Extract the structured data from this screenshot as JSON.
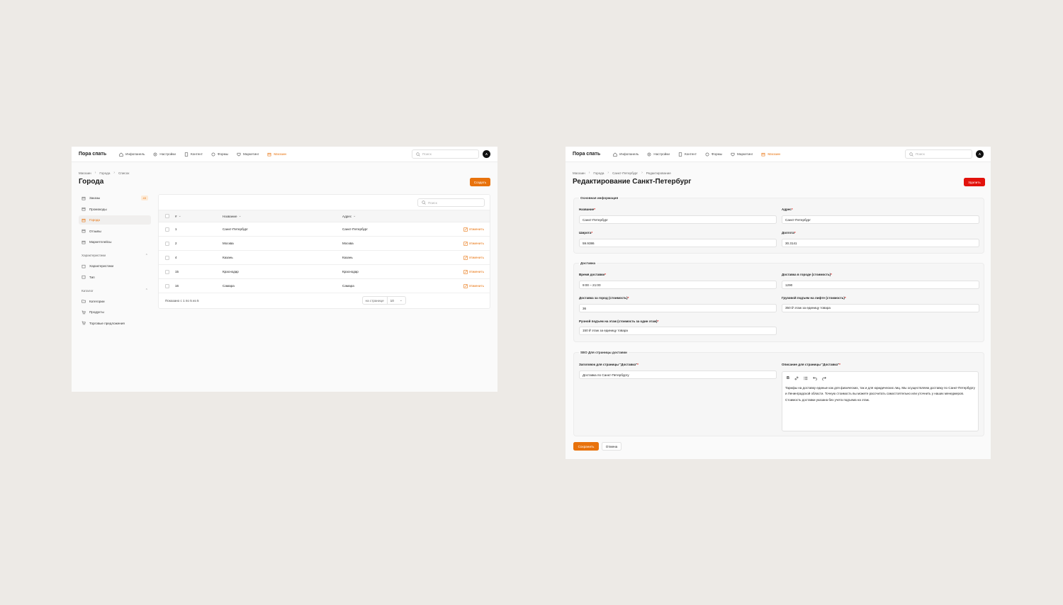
{
  "colors": {
    "accent": "#e8720c",
    "danger": "#e2120c",
    "background": "#edeae6"
  },
  "brand": "Пора спать",
  "nav": [
    {
      "label": "Инфопанель",
      "icon": "home-icon"
    },
    {
      "label": "Настройки",
      "icon": "gear-icon"
    },
    {
      "label": "Контент",
      "icon": "document-icon"
    },
    {
      "label": "Формы",
      "icon": "forms-icon"
    },
    {
      "label": "Маркетинг",
      "icon": "megaphone-icon"
    },
    {
      "label": "Магазин",
      "icon": "store-icon",
      "active": true
    }
  ],
  "search_placeholder": "Поиск",
  "avatar_initial": "A",
  "list_page": {
    "breadcrumbs": [
      "Магазин",
      "Города",
      "Список"
    ],
    "title": "Города",
    "create_button": "Создать",
    "sidebar": {
      "shop_items": [
        {
          "label": "Заказы",
          "badge": "43"
        },
        {
          "label": "Промокоды"
        },
        {
          "label": "Города",
          "active": true
        },
        {
          "label": "Отзывы"
        },
        {
          "label": "Маркетплейсы"
        }
      ],
      "characteristics_section": "Характеристики",
      "characteristics_items": [
        {
          "label": "Характеристики"
        },
        {
          "label": "Тип"
        }
      ],
      "catalog_section": "Каталог",
      "catalog_items": [
        {
          "label": "Категории"
        },
        {
          "label": "Продукты"
        },
        {
          "label": "Торговые предложения"
        }
      ]
    },
    "table": {
      "search_placeholder": "Поиск",
      "columns": {
        "id": "#",
        "name": "Название",
        "address": "Адрес"
      },
      "edit_label": "Изменить",
      "rows": [
        {
          "id": "1",
          "name": "Санкт-Петербург",
          "address": "Санкт-Петербург"
        },
        {
          "id": "2",
          "name": "Москва",
          "address": "Москва"
        },
        {
          "id": "4",
          "name": "Казань",
          "address": "Казань"
        },
        {
          "id": "15",
          "name": "Краснодар",
          "address": "Краснодар"
        },
        {
          "id": "16",
          "name": "Самара",
          "address": "Самара"
        }
      ],
      "summary": "Показано с 1 по 5 из 5",
      "per_page_label": "на странице",
      "per_page_value": "10"
    }
  },
  "edit_page": {
    "breadcrumbs": [
      "Магазин",
      "Города",
      "Санкт-Петербург",
      "Редактирование"
    ],
    "title": "Редактирование Санкт-Петербург",
    "delete_button": "Удалить",
    "basic": {
      "legend": "Основная информация",
      "name_label": "Название",
      "name_value": "Санкт-Петербург",
      "address_label": "Адрес",
      "address_value": "Санкт-Петербург",
      "lat_label": "Широта",
      "lat_value": "59.9386",
      "lon_label": "Долгота",
      "lon_value": "30.3141"
    },
    "delivery": {
      "legend": "Доставка",
      "time_label": "Время доставки",
      "time_value": "9:00 – 21:00",
      "city_label": "Доставка в городе (стоимость)",
      "city_value": "1290",
      "outside_label": "Доставка за город (стоимость)",
      "outside_value": "36",
      "lift_label": "Грузовой подъем на лифте (стоимость)",
      "lift_value": "350 ₽ этаж за единицу товара",
      "manual_label": "Ручной подъем на этаж (стоимость за один этаж)",
      "manual_value": "150 ₽ этаж за единицу товара"
    },
    "seo": {
      "legend": "SEO Для страницы доставки",
      "title_label": "Заголовок для страницы \"Доставка\"",
      "title_value": "Доставка по Санкт-Петербургу",
      "desc_label": "Описание для страницы \"Доставка\"",
      "desc_value": "Тарифы на доставку единые как для физических, так и для юридических лиц. Мы осуществляем доставку по Санкт-Петербургу и Ленинградской области. Точную стоимость вы можете рассчитать самостоятельно или уточнить у наших менеджеров. Стоимость доставки указана без учета подъема на этаж."
    },
    "save_button": "Сохранить",
    "cancel_button": "Отмена"
  }
}
